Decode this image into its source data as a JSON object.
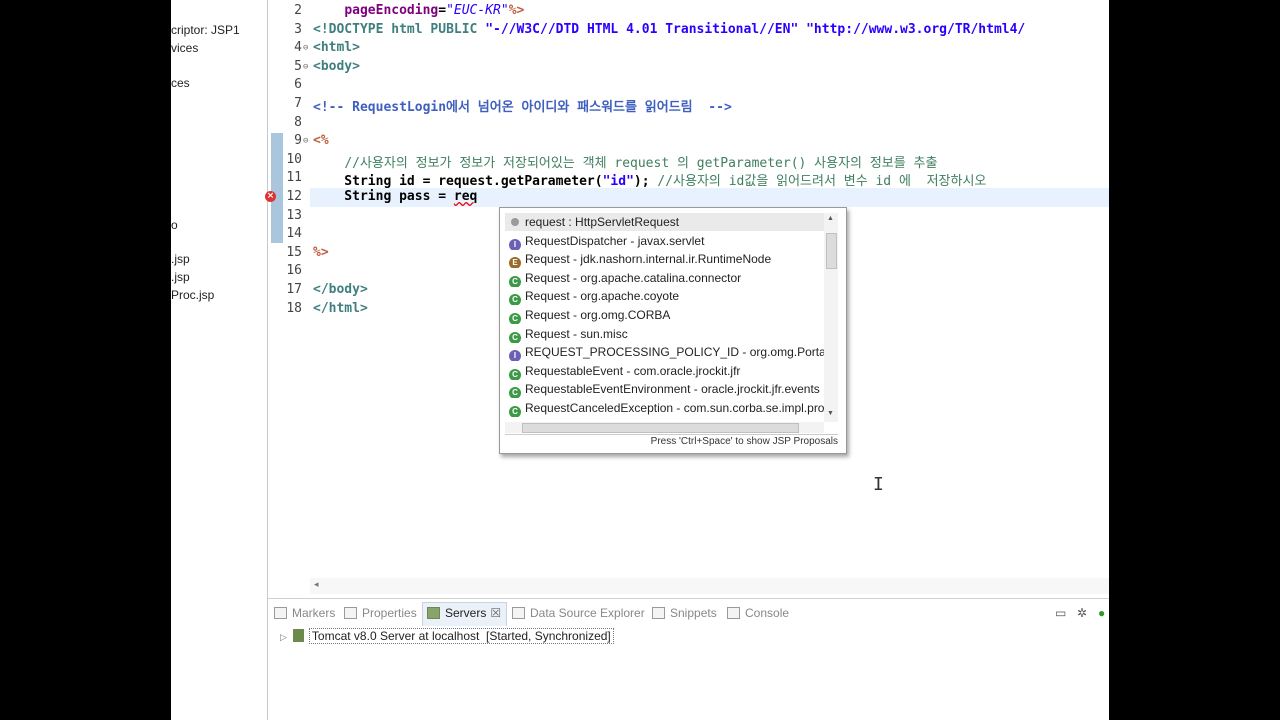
{
  "explorer": {
    "items": [
      "criptor: JSP1",
      "vices",
      "ces",
      "o",
      ".jsp",
      ".jsp",
      "Proc.jsp"
    ]
  },
  "editor": {
    "lines": [
      {
        "num": "2",
        "html": "    <span class=\"attr\">pageEncoding</span>=<span class=\"str\">\"EUC-KR\"</span><span class=\"jsp\">%&gt;</span>"
      },
      {
        "num": "3",
        "html": "<span class=\"tag\">&lt;!DOCTYPE</span> <span class=\"tag\">html PUBLIC</span> <span class=\"strb\">\"-//W3C//DTD HTML 4.01 Transitional//EN\"</span> <span class=\"strb\">\"http://www.w3.org/TR/html4/</span>"
      },
      {
        "num": "4",
        "html": "<span class=\"tag\">&lt;html&gt;</span>"
      },
      {
        "num": "5",
        "html": "<span class=\"tag\">&lt;body&gt;</span>"
      },
      {
        "num": "6",
        "html": ""
      },
      {
        "num": "7",
        "html": "<span class=\"cmt\">&lt;!-- RequestLogin에서 넘어온 아이디와 패스워드를 읽어드림  --&gt;</span>"
      },
      {
        "num": "8",
        "html": ""
      },
      {
        "num": "9",
        "html": "<span class=\"jsp\">&lt;%</span>"
      },
      {
        "num": "10",
        "html": "    <span class=\"jcmt\">//사용자의 정보가 정보가 저장되어있는 객체 request 의 getParameter() 사용자의 정보를 추출</span>"
      },
      {
        "num": "11",
        "html": "    String id = request.getParameter(<span class=\"strb\">\"id\"</span>); <span class=\"jcmt\">//사용자의 id값을 읽어드려서 변수 id 에  저장하시오</span>"
      },
      {
        "num": "12",
        "html": "    String pass = <span class=\"sq\">req</span>"
      },
      {
        "num": "13",
        "html": ""
      },
      {
        "num": "14",
        "html": ""
      },
      {
        "num": "15",
        "html": "<span class=\"jsp\">%&gt;</span>"
      },
      {
        "num": "16",
        "html": ""
      },
      {
        "num": "17",
        "html": "<span class=\"tag\">&lt;/body&gt;</span>"
      },
      {
        "num": "18",
        "html": "<span class=\"tag\">&lt;/html&gt;</span>"
      }
    ]
  },
  "autocomplete": {
    "items": [
      {
        "icon": "v",
        "text": "request : HttpServletRequest"
      },
      {
        "icon": "i",
        "text": "RequestDispatcher - javax.servlet"
      },
      {
        "icon": "e",
        "text": "Request - jdk.nashorn.internal.ir.RuntimeNode"
      },
      {
        "icon": "c",
        "text": "Request - org.apache.catalina.connector"
      },
      {
        "icon": "c",
        "text": "Request - org.apache.coyote"
      },
      {
        "icon": "c",
        "text": "Request - org.omg.CORBA"
      },
      {
        "icon": "c",
        "text": "Request - sun.misc"
      },
      {
        "icon": "i",
        "text": "REQUEST_PROCESSING_POLICY_ID - org.omg.PortableSe"
      },
      {
        "icon": "c",
        "text": "RequestableEvent - com.oracle.jrockit.jfr"
      },
      {
        "icon": "c",
        "text": "RequestableEventEnvironment - oracle.jrockit.jfr.events"
      },
      {
        "icon": "c",
        "text": "RequestCanceledException - com.sun.corba.se.impl.prot"
      }
    ],
    "status": "Press 'Ctrl+Space' to show JSP Proposals"
  },
  "panel": {
    "tabs": {
      "markers": "Markers",
      "properties": "Properties",
      "servers": "Servers",
      "datasource": "Data Source Explorer",
      "snippets": "Snippets",
      "console": "Console"
    },
    "server": {
      "name": "Tomcat v8.0 Server at localhost",
      "state": "[Started, Synchronized]"
    }
  }
}
